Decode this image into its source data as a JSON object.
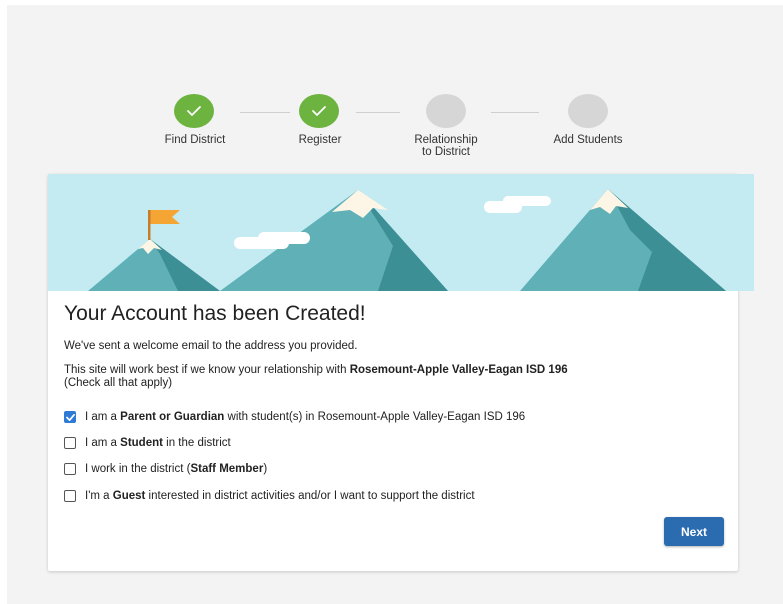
{
  "stepper": {
    "steps": [
      {
        "label": "Find District",
        "status": "complete"
      },
      {
        "label": "Register",
        "status": "complete"
      },
      {
        "label_line1": "Relationship",
        "label_line2": "to District",
        "status": "pending"
      },
      {
        "label": "Add Students",
        "status": "pending"
      }
    ]
  },
  "card": {
    "title": "Your Account has been Created!",
    "welcome_text": "We've sent a welcome email to the address you provided.",
    "intro_prefix": "This site will work best if we know your relationship with ",
    "district_name": "Rosemount-Apple Valley-Eagan ISD 196",
    "intro_hint": "(Check all that apply)",
    "options": [
      {
        "prefix": "I am a ",
        "bold": "Parent or Guardian",
        "suffix": " with student(s) in Rosemount-Apple Valley-Eagan ISD 196",
        "checked": true
      },
      {
        "prefix": "I am a ",
        "bold": "Student",
        "suffix": " in the district",
        "checked": false
      },
      {
        "prefix": "I work in the district (",
        "bold": "Staff Member",
        "suffix": ")",
        "checked": false
      },
      {
        "prefix": "I'm a ",
        "bold": "Guest",
        "suffix": " interested in district activities and/or I want to support the district",
        "checked": false
      }
    ],
    "next_label": "Next"
  },
  "colors": {
    "complete": "#6cb33f",
    "pending": "#d6d6d6",
    "accent": "#2b6cb0",
    "banner_sky": "#c5ebf2"
  }
}
